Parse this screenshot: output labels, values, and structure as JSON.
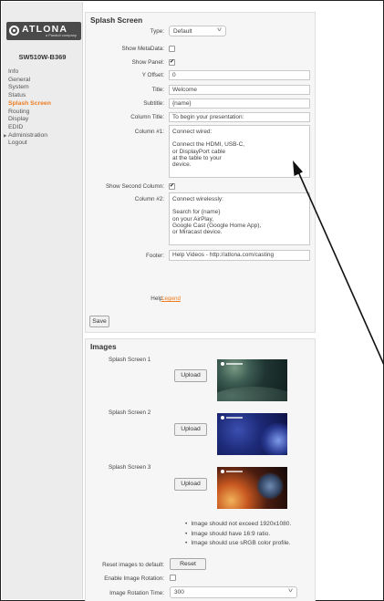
{
  "sidebar": {
    "logo_text": "ATLONA",
    "logo_tagline": "a Panduit company",
    "model": "SW510W-B369",
    "items": [
      {
        "label": "Info",
        "active": false
      },
      {
        "label": "General",
        "active": false
      },
      {
        "label": "System",
        "active": false
      },
      {
        "label": "Status",
        "active": false
      },
      {
        "label": "Splash Screen",
        "active": true
      },
      {
        "label": "Routing",
        "active": false
      },
      {
        "label": "Display",
        "active": false
      },
      {
        "label": "EDID",
        "active": false
      },
      {
        "label": "Administration",
        "active": false,
        "expandable": true
      },
      {
        "label": "Logout",
        "active": false
      }
    ]
  },
  "splash": {
    "title": "Splash Screen",
    "type_label": "Type:",
    "type_value": "Default",
    "show_metadata_label": "Show MetaData:",
    "show_metadata": false,
    "show_panel_label": "Show Panel:",
    "show_panel": true,
    "y_offset_label": "Y Offset:",
    "y_offset_value": "0",
    "title_label": "Title:",
    "title_value": "Welcome",
    "subtitle_label": "Subtitle:",
    "subtitle_value": "{name}",
    "column_title_label": "Column Title:",
    "column_title_value": "To begin your presentation:",
    "column1_label": "Column #1:",
    "column1_lines": [
      "Connect wired:",
      "",
      "Connect the HDMI, USB-C,",
      "or DisplayPort cable",
      "at the table to your",
      "device."
    ],
    "show_second_column_label": "Show Second Column:",
    "show_second_column": true,
    "column2_label": "Column #2:",
    "column2_lines": [
      "Connect wirelessly:",
      "",
      "Search for {name}",
      "on your AirPlay,",
      "Google Cast (Google Home App),",
      "or Miracast device."
    ],
    "footer_label": "Footer:",
    "footer_value": "Help Videos - http://atlona.com/casting",
    "help_label": "Help:",
    "help_link": "Legend",
    "save_label": "Save"
  },
  "images": {
    "title": "Images",
    "screens": [
      {
        "label": "Splash Screen 1",
        "upload_label": "Upload"
      },
      {
        "label": "Splash Screen 2",
        "upload_label": "Upload"
      },
      {
        "label": "Splash Screen 3",
        "upload_label": "Upload"
      }
    ],
    "notes": [
      "Image should not exceed 1920x1080.",
      "Image should have 16:9 ratio.",
      "Image should use sRGB color profile."
    ],
    "reset_label": "Reset images to default:",
    "reset_button": "Reset",
    "enable_rotation_label": "Enable Image Rotation:",
    "enable_rotation": false,
    "rotation_time_label": "Image Rotation Time:",
    "rotation_time_value": "300"
  },
  "colors": {
    "accent": "#ef7c1f",
    "sidebar_bg": "#ececec",
    "panel_bg": "#f6f6f6"
  }
}
